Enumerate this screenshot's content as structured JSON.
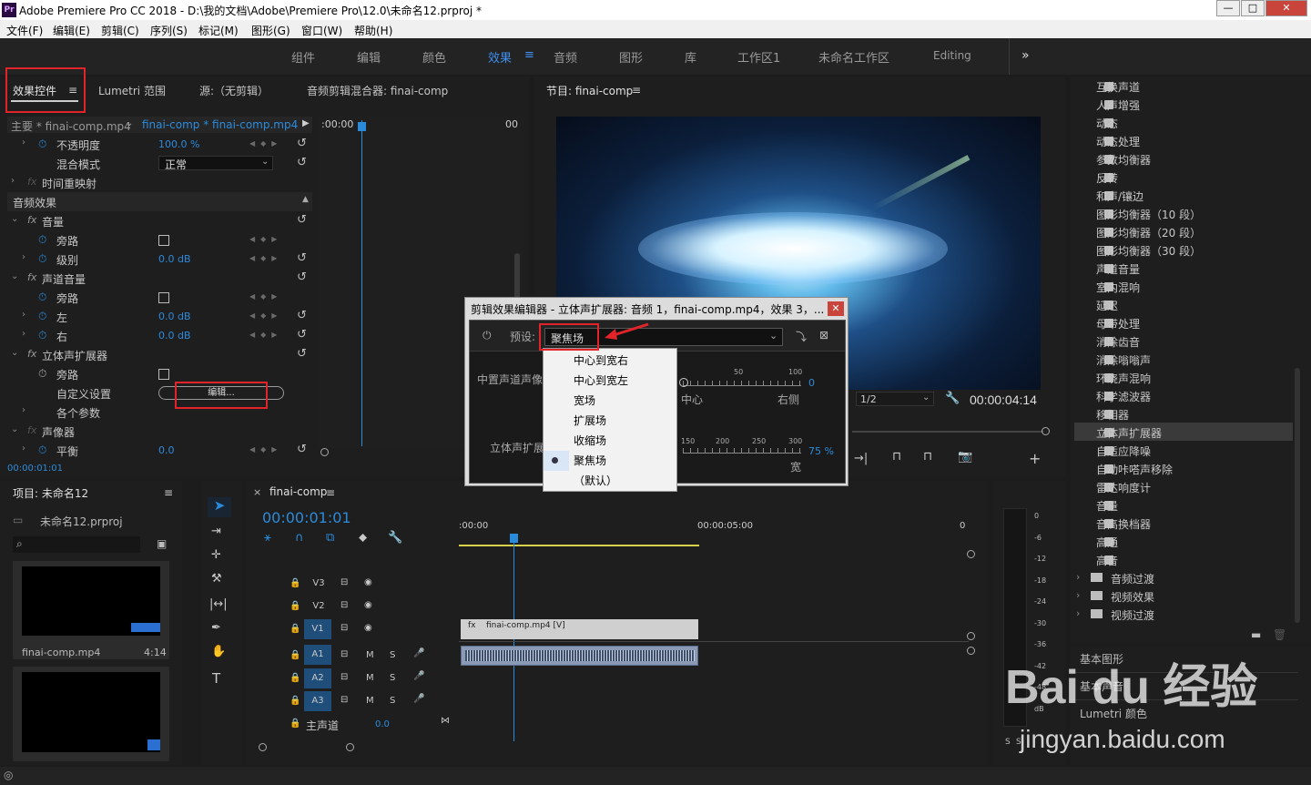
{
  "window": {
    "title": "Adobe Premiere Pro CC 2018 - D:\\我的文档\\Adobe\\Premiere Pro\\12.0\\未命名12.prproj *",
    "logo": "Pr",
    "min": "—",
    "max": "□",
    "close": "✕"
  },
  "menu": [
    "文件(F)",
    "编辑(E)",
    "剪辑(C)",
    "序列(S)",
    "标记(M)",
    "图形(G)",
    "窗口(W)",
    "帮助(H)"
  ],
  "workspaces": [
    "组件",
    "编辑",
    "颜色",
    "效果",
    "音频",
    "图形",
    "库",
    "工作区1",
    "未命名工作区",
    "Editing"
  ],
  "workspace_active": "效果",
  "workspace_more": "»",
  "effect_controls": {
    "tabs": [
      "效果控件",
      "Lumetri 范围",
      "源:（无剪辑）",
      "音频剪辑混合器: finai-comp"
    ],
    "master": "主要 * finai-comp.mp4",
    "clip": "finai-comp * finai-comp.mp4",
    "timecode_start": ":00:00",
    "timecode_end": "00",
    "opacity_label": "不透明度",
    "opacity_value": "100.0 %",
    "blend_label": "混合模式",
    "blend_value": "正常",
    "time_remap": "时间重映射",
    "audio_effects": "音频效果",
    "volume": "音量",
    "bypass": "旁路",
    "level": "级别",
    "level_value": "0.0 dB",
    "channel_volume": "声道音量",
    "left": "左",
    "left_value": "0.0 dB",
    "right": "右",
    "right_value": "0.0 dB",
    "stereo_expander": "立体声扩展器",
    "custom_setup": "自定义设置",
    "edit_button": "编辑...",
    "params": "各个参数",
    "panner": "声像器",
    "balance": "平衡",
    "balance_value": "0.0",
    "current_time": "00:00:01:01"
  },
  "program": {
    "title": "节目: finai-comp",
    "scale": "1/2",
    "timecode": "00:00:04:14"
  },
  "effects_list": [
    "互换声道",
    "人声增强",
    "动态",
    "动态处理",
    "参数均衡器",
    "反转",
    "和声/镶边",
    "图形均衡器（10 段）",
    "图形均衡器（20 段）",
    "图形均衡器（30 段）",
    "声道音量",
    "室内混响",
    "延迟",
    "母带处理",
    "消除齿音",
    "消除嗡嗡声",
    "环绕声混响",
    "科学滤波器",
    "移相器",
    "立体声扩展器",
    "自适应降噪",
    "自动咔嗒声移除",
    "雷达响度计",
    "音量",
    "音高换档器",
    "高通",
    "高音"
  ],
  "effects_selected": "立体声扩展器",
  "effects_folders": [
    "音频过渡",
    "视频效果",
    "视频过渡"
  ],
  "bottom_panels": [
    "基本图形",
    "基本声音",
    "Lumetri 颜色"
  ],
  "project": {
    "title": "项目: 未命名12",
    "file": "未命名12.prproj",
    "clip_name": "finai-comp.mp4",
    "clip_duration": "4:14"
  },
  "timeline": {
    "tab": "finai-comp",
    "timecode": "00:00:01:01",
    "ruler": [
      ":00:00",
      "00:00:05:00",
      "0"
    ],
    "video_tracks": [
      "V3",
      "V2",
      "V1"
    ],
    "audio_tracks": [
      "A1",
      "A2",
      "A3"
    ],
    "master": "主声道",
    "master_value": "0.0",
    "clip_label": "finai-comp.mp4 [V]"
  },
  "meter_scale": [
    "0",
    "-6",
    "-12",
    "-18",
    "-24",
    "-30",
    "-36",
    "-42",
    "-48",
    "dB"
  ],
  "meter_footer": [
    "S",
    "S"
  ],
  "dialog": {
    "title": "剪辑效果编辑器 - 立体声扩展器: 音频 1，finai-comp.mp4，效果 3，...",
    "preset_label": "预设:",
    "preset_value": "聚焦场",
    "center_label": "中置声道声像",
    "center_ticks": [
      "0",
      "50",
      "100"
    ],
    "center_value": "0",
    "center_ends": [
      "中心",
      "右侧"
    ],
    "expand_label": "立体声扩展",
    "expand_ticks": [
      "150",
      "200",
      "250",
      "300"
    ],
    "expand_value": "75 %",
    "expand_end": "宽",
    "options": [
      "中心到宽右",
      "中心到宽左",
      "宽场",
      "扩展场",
      "收缩场",
      "聚焦场",
      "（默认）"
    ],
    "selected_option": "聚焦场"
  },
  "watermark": {
    "logo": "Bai du 经验",
    "url": "jingyan.baidu.com"
  }
}
